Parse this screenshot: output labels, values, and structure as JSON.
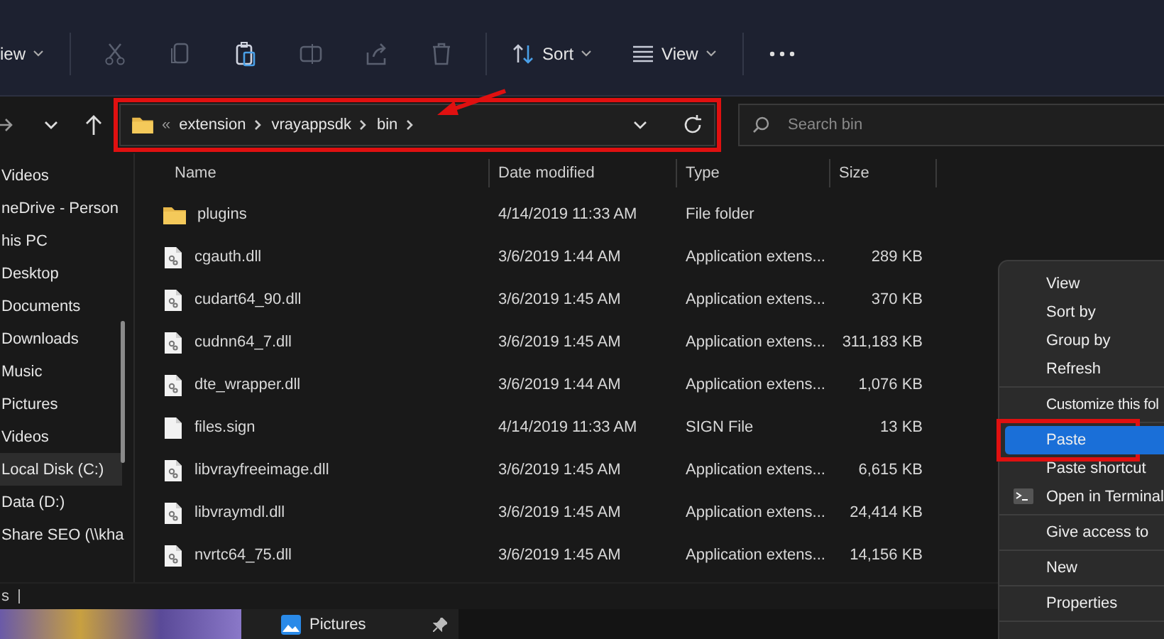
{
  "toolbar": {
    "new_label": "iew",
    "sort_label": "Sort",
    "view_label": "View"
  },
  "address_bar": {
    "overflow_mark": "«",
    "crumbs": [
      "extension",
      "vrayappsdk",
      "bin"
    ],
    "highlighted": true
  },
  "search": {
    "placeholder": "Search bin"
  },
  "sidebar": {
    "items": [
      {
        "label": "Videos",
        "selected": false
      },
      {
        "label": "neDrive - Person",
        "selected": false
      },
      {
        "label": "his PC",
        "selected": false
      },
      {
        "label": "Desktop",
        "selected": false
      },
      {
        "label": "Documents",
        "selected": false
      },
      {
        "label": "Downloads",
        "selected": false
      },
      {
        "label": "Music",
        "selected": false
      },
      {
        "label": "Pictures",
        "selected": false
      },
      {
        "label": "Videos",
        "selected": false
      },
      {
        "label": "Local Disk (C:)",
        "selected": true
      },
      {
        "label": "Data (D:)",
        "selected": false
      },
      {
        "label": "Share SEO (\\\\kha",
        "selected": false
      }
    ]
  },
  "table": {
    "columns": [
      "Name",
      "Date modified",
      "Type",
      "Size"
    ],
    "rows": [
      {
        "kind": "folder",
        "name": "plugins",
        "date": "4/14/2019 11:33 AM",
        "type": "File folder",
        "size": ""
      },
      {
        "kind": "dll",
        "name": "cgauth.dll",
        "date": "3/6/2019 1:44 AM",
        "type": "Application extens...",
        "size": "289 KB"
      },
      {
        "kind": "dll",
        "name": "cudart64_90.dll",
        "date": "3/6/2019 1:45 AM",
        "type": "Application extens...",
        "size": "370 KB"
      },
      {
        "kind": "dll",
        "name": "cudnn64_7.dll",
        "date": "3/6/2019 1:45 AM",
        "type": "Application extens...",
        "size": "311,183 KB"
      },
      {
        "kind": "dll",
        "name": "dte_wrapper.dll",
        "date": "3/6/2019 1:44 AM",
        "type": "Application extens...",
        "size": "1,076 KB"
      },
      {
        "kind": "file",
        "name": "files.sign",
        "date": "4/14/2019 11:33 AM",
        "type": "SIGN File",
        "size": "13 KB"
      },
      {
        "kind": "dll",
        "name": "libvrayfreeimage.dll",
        "date": "3/6/2019 1:45 AM",
        "type": "Application extens...",
        "size": "6,615 KB"
      },
      {
        "kind": "dll",
        "name": "libvraymdl.dll",
        "date": "3/6/2019 1:45 AM",
        "type": "Application extens...",
        "size": "24,414 KB"
      },
      {
        "kind": "dll",
        "name": "nvrtc64_75.dll",
        "date": "3/6/2019 1:45 AM",
        "type": "Application extens...",
        "size": "14,156 KB"
      }
    ]
  },
  "status_bar": {
    "text": "s"
  },
  "taskbar_popup": {
    "item": "Pictures"
  },
  "context_menu": {
    "groups": [
      [
        {
          "label": "View",
          "selected": false
        },
        {
          "label": "Sort by",
          "selected": false
        },
        {
          "label": "Group by",
          "selected": false
        },
        {
          "label": "Refresh",
          "selected": false
        }
      ],
      [
        {
          "label": "Customize this fol",
          "selected": false
        }
      ],
      [
        {
          "label": "Paste",
          "selected": true,
          "highlighted": true
        },
        {
          "label": "Paste shortcut",
          "selected": false
        },
        {
          "label": "Open in Terminal",
          "selected": false,
          "kind": "terminal"
        }
      ],
      [
        {
          "label": "Give access to",
          "selected": false
        }
      ],
      [
        {
          "label": "New",
          "selected": false
        }
      ],
      [
        {
          "label": "Properties",
          "selected": false
        }
      ]
    ]
  }
}
